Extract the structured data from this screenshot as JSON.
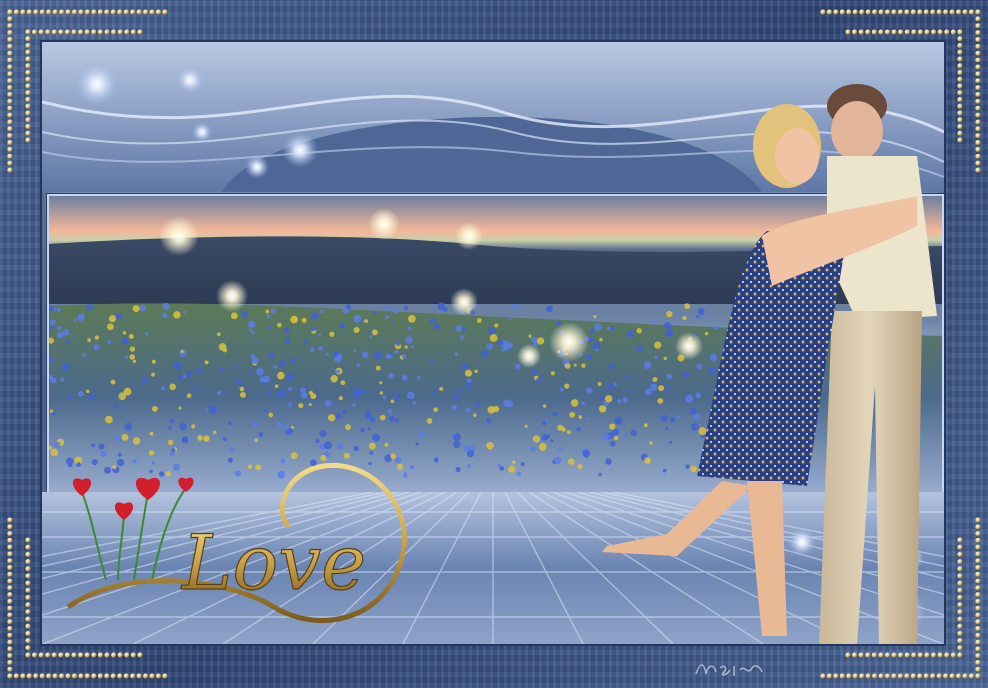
{
  "artwork": {
    "word": "Love"
  },
  "colors": {
    "frame": "#3d5584",
    "panel": "#6b84b0",
    "gold": "#c8a24a",
    "heart": "#d21f2b"
  }
}
